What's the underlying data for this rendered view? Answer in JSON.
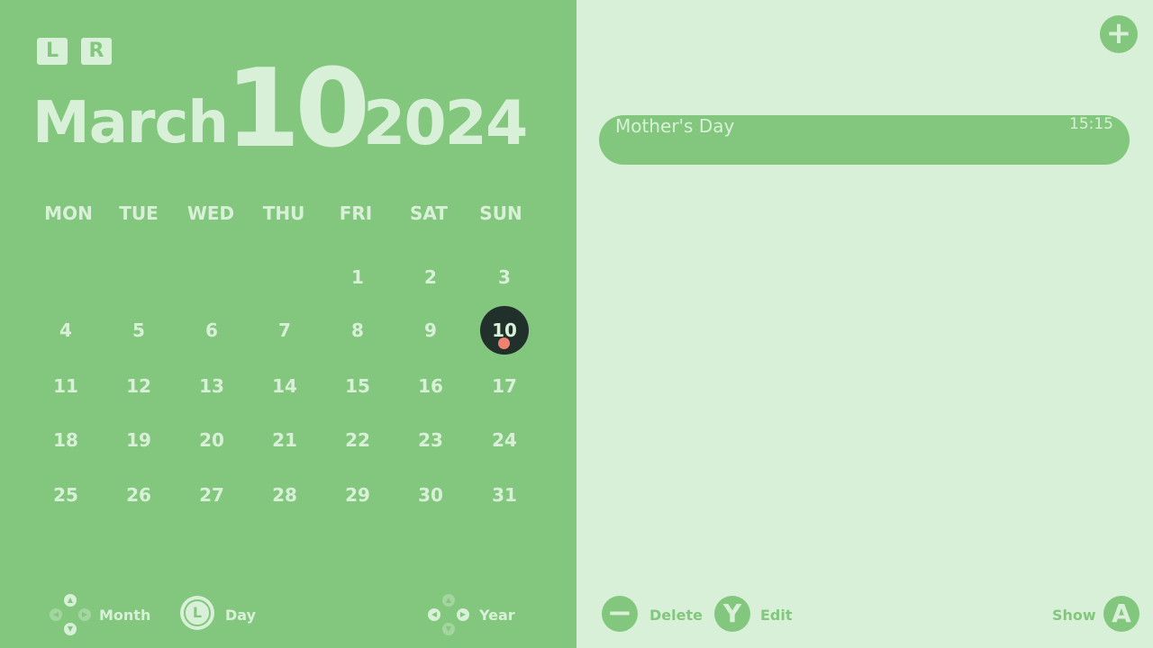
{
  "buttons": {
    "l": "L",
    "r": "R",
    "add": "+"
  },
  "date": {
    "month": "March",
    "day": "10",
    "year": "2024"
  },
  "weekdays": [
    "MON",
    "TUE",
    "WED",
    "THU",
    "FRI",
    "SAT",
    "SUN"
  ],
  "days": [
    "1",
    "2",
    "3",
    "4",
    "5",
    "6",
    "7",
    "8",
    "9",
    "10",
    "11",
    "12",
    "13",
    "14",
    "15",
    "16",
    "17",
    "18",
    "19",
    "20",
    "21",
    "22",
    "23",
    "24",
    "25",
    "26",
    "27",
    "28",
    "29",
    "30",
    "31"
  ],
  "selected_day": "10",
  "hints_left": {
    "month": "Month",
    "day": "Day",
    "year": "Year",
    "stick_letter": "L"
  },
  "event": {
    "title": "Mother's Day",
    "time": "15:15"
  },
  "hints_right": {
    "delete": "Delete",
    "delete_symbol": "−",
    "edit": "Edit",
    "edit_symbol": "Y",
    "show": "Show",
    "show_symbol": "A"
  },
  "colors": {
    "panel": "#82c77d",
    "background": "#d9f0d8",
    "selected": "#21302a",
    "event_dot": "#f08070"
  },
  "icons": {
    "dpad": "dpad-icon",
    "stick": "left-stick-icon"
  }
}
